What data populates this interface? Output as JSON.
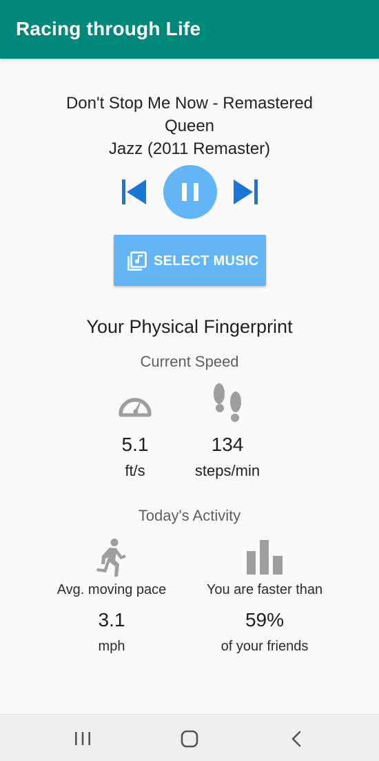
{
  "app_bar": {
    "title": "Racing through Life",
    "color": "#00897b"
  },
  "now_playing": {
    "title": "Don't Stop Me Now - Remastered",
    "artist": "Queen",
    "album": "Jazz (2011 Remaster)",
    "controls": {
      "prev_icon": "skip-previous-icon",
      "play_pause_icon": "pause-icon",
      "next_icon": "skip-next-icon"
    },
    "accent": "#1976d2",
    "button_color": "#64b5f6"
  },
  "select_music": {
    "label": "SELECT MUSIC",
    "icon": "library-music-icon"
  },
  "fingerprint": {
    "heading": "Your Physical Fingerprint",
    "current_speed": {
      "heading": "Current Speed",
      "speed": {
        "icon": "speedometer-icon",
        "value": "5.1",
        "unit": "ft/s"
      },
      "cadence": {
        "icon": "footsteps-icon",
        "value": "134",
        "unit": "steps/min"
      }
    },
    "todays_activity": {
      "heading": "Today's Activity",
      "pace": {
        "icon": "running-person-icon",
        "label": "Avg. moving pace",
        "value": "3.1",
        "unit": "mph"
      },
      "ranking": {
        "icon": "bar-chart-icon",
        "label": "You are faster than",
        "value": "59%",
        "unit": "of your friends"
      }
    }
  },
  "nav_bar": {
    "recents_icon": "recents-icon",
    "home_icon": "home-icon",
    "back_icon": "back-icon"
  }
}
